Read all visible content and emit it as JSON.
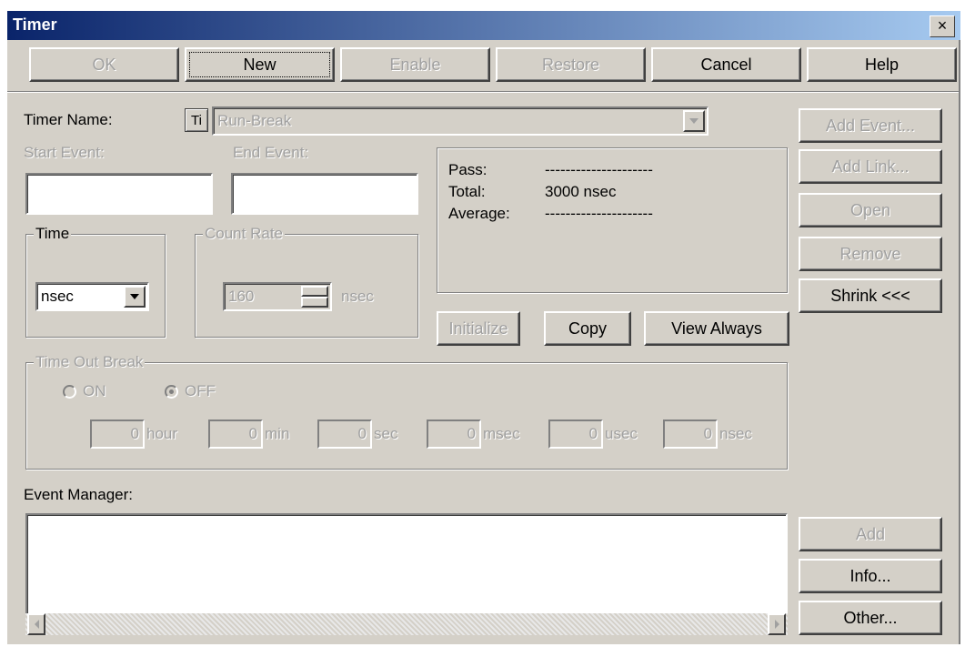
{
  "window": {
    "title": "Timer",
    "close_glyph": "×"
  },
  "toolbar": {
    "ok": "OK",
    "new": "New",
    "enable": "Enable",
    "restore": "Restore",
    "cancel": "Cancel",
    "help": "Help"
  },
  "timer_name": {
    "label": "Timer Name:",
    "icon_text": "Ti",
    "value": "Run-Break"
  },
  "start_event": {
    "label": "Start Event:",
    "value": ""
  },
  "end_event": {
    "label": "End Event:",
    "value": ""
  },
  "stats": {
    "pass_label": "Pass:",
    "pass_value": "---------------------",
    "total_label": "Total:",
    "total_value": "3000 nsec",
    "average_label": "Average:",
    "average_value": "---------------------"
  },
  "time_group": {
    "label": "Time",
    "selected": "nsec"
  },
  "count_rate": {
    "label": "Count Rate",
    "value": "160",
    "unit": "nsec"
  },
  "actions": {
    "initialize": "Initialize",
    "copy": "Copy",
    "view_always": "View Always"
  },
  "side_buttons": {
    "add_event": "Add Event...",
    "add_link": "Add Link...",
    "open": "Open",
    "remove": "Remove",
    "shrink": "Shrink <<<"
  },
  "timeout_break": {
    "label": "Time Out Break",
    "on_label": "ON",
    "off_label": "OFF",
    "selected": "OFF",
    "fields": [
      {
        "value": "0",
        "unit": "hour"
      },
      {
        "value": "0",
        "unit": "min"
      },
      {
        "value": "0",
        "unit": "sec"
      },
      {
        "value": "0",
        "unit": "msec"
      },
      {
        "value": "0",
        "unit": "usec"
      },
      {
        "value": "0",
        "unit": "nsec"
      }
    ]
  },
  "event_manager": {
    "label": "Event Manager:"
  },
  "bottom_buttons": {
    "add": "Add",
    "info": "Info...",
    "other": "Other..."
  }
}
